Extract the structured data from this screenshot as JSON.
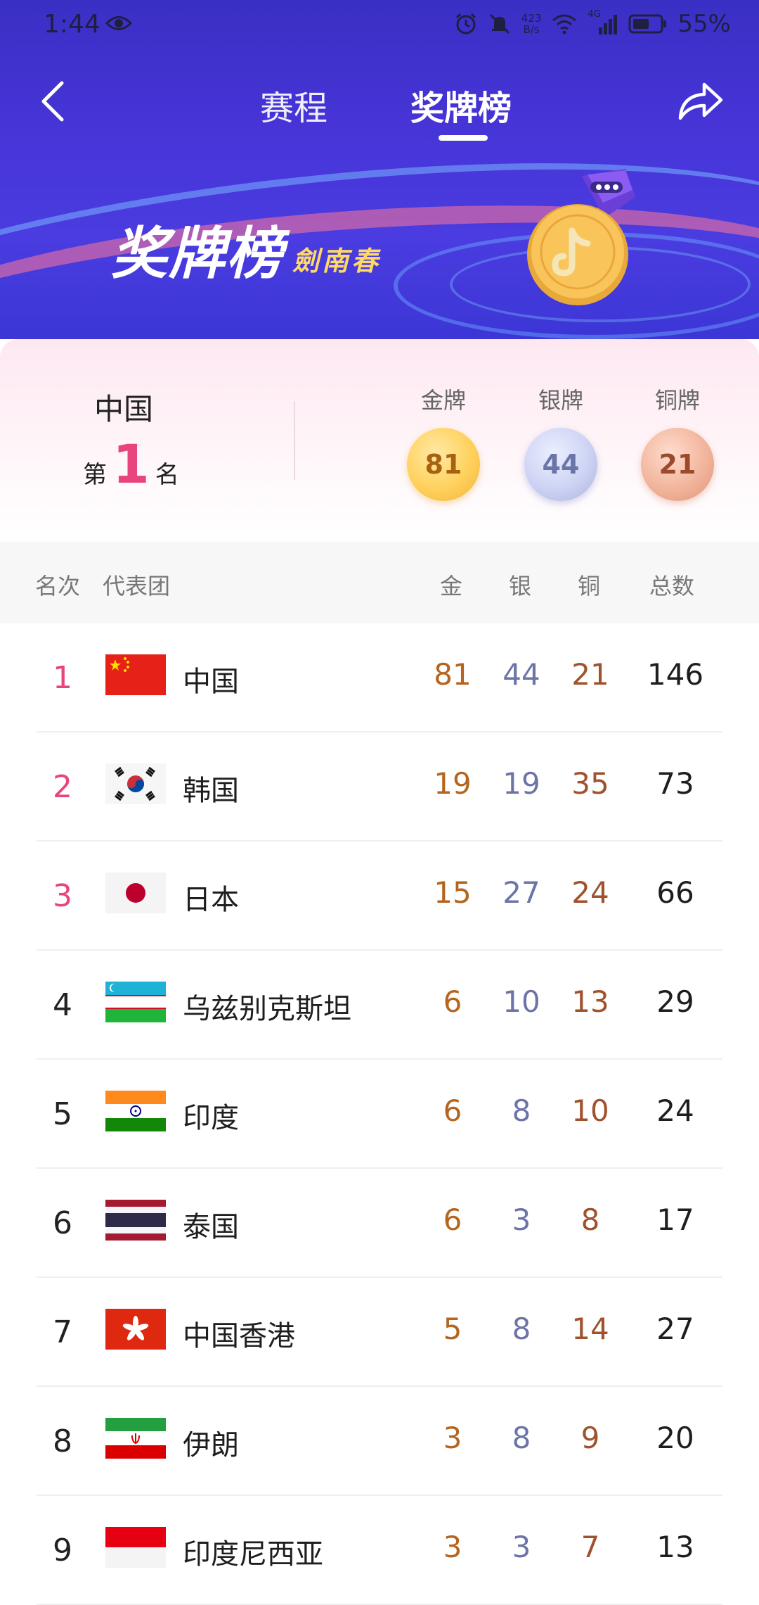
{
  "status_bar": {
    "time": "1:44",
    "net_speed_value": "423",
    "net_speed_unit": "B/s",
    "network_type": "4G",
    "battery": "55%"
  },
  "nav": {
    "tabs": [
      {
        "label": "赛程",
        "active": false
      },
      {
        "label": "奖牌榜",
        "active": true
      }
    ]
  },
  "banner": {
    "title": "奖牌榜",
    "sponsor": "劍南春"
  },
  "summary": {
    "country": "中国",
    "rank_prefix": "第",
    "rank": "1",
    "rank_suffix": "名",
    "gold_label": "金牌",
    "silver_label": "银牌",
    "bronze_label": "铜牌",
    "gold": "81",
    "silver": "44",
    "bronze": "21"
  },
  "table": {
    "headers": {
      "rank": "名次",
      "delegation": "代表团",
      "gold": "金",
      "silver": "银",
      "bronze": "铜",
      "total": "总数"
    },
    "rows": [
      {
        "rank": "1",
        "name": "中国",
        "flag": "flag-china",
        "gold": "81",
        "silver": "44",
        "bronze": "21",
        "total": "146"
      },
      {
        "rank": "2",
        "name": "韩国",
        "flag": "flag-south-korea",
        "gold": "19",
        "silver": "19",
        "bronze": "35",
        "total": "73"
      },
      {
        "rank": "3",
        "name": "日本",
        "flag": "flag-japan",
        "gold": "15",
        "silver": "27",
        "bronze": "24",
        "total": "66"
      },
      {
        "rank": "4",
        "name": "乌兹别克斯坦",
        "flag": "flag-uzbekistan",
        "gold": "6",
        "silver": "10",
        "bronze": "13",
        "total": "29"
      },
      {
        "rank": "5",
        "name": "印度",
        "flag": "flag-india",
        "gold": "6",
        "silver": "8",
        "bronze": "10",
        "total": "24"
      },
      {
        "rank": "6",
        "name": "泰国",
        "flag": "flag-thailand",
        "gold": "6",
        "silver": "3",
        "bronze": "8",
        "total": "17"
      },
      {
        "rank": "7",
        "name": "中国香港",
        "flag": "flag-hong-kong",
        "gold": "5",
        "silver": "8",
        "bronze": "14",
        "total": "27"
      },
      {
        "rank": "8",
        "name": "伊朗",
        "flag": "flag-iran",
        "gold": "3",
        "silver": "8",
        "bronze": "9",
        "total": "20"
      },
      {
        "rank": "9",
        "name": "印度尼西亚",
        "flag": "flag-indonesia",
        "gold": "3",
        "silver": "3",
        "bronze": "7",
        "total": "13"
      }
    ]
  },
  "colors": {
    "header_bg": "#4634d6",
    "rank_top": "#e8447d",
    "gold_text": "#b5651d",
    "silver_text": "#6c74a8",
    "bronze_text": "#a0522d"
  }
}
